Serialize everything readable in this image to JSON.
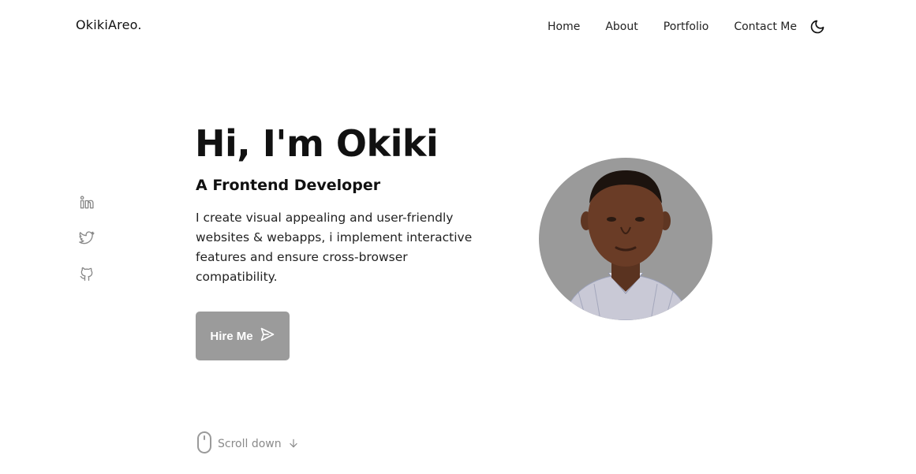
{
  "header": {
    "logo": "OkikiAreo.",
    "nav": [
      {
        "label": "Home"
      },
      {
        "label": "About"
      },
      {
        "label": "Portfolio"
      },
      {
        "label": "Contact Me"
      }
    ],
    "theme_toggle_icon": "moon-icon"
  },
  "social": [
    {
      "icon": "linkedin-icon"
    },
    {
      "icon": "twitter-icon"
    },
    {
      "icon": "github-icon"
    }
  ],
  "hero": {
    "title": "Hi, I'm Okiki",
    "subtitle": "A Frontend Developer",
    "description": "I create visual appealing and user-friendly websites & webapps, i implement interactive features and ensure cross-browser compatibility.",
    "cta_label": "Hire Me",
    "cta_icon": "send-icon",
    "avatar_icon": "profile-photo"
  },
  "scroll": {
    "label": "Scroll down",
    "mouse_icon": "mouse-icon",
    "arrow_icon": "arrow-down-icon"
  },
  "colors": {
    "accent": "#9b9b9b",
    "text": "#111111",
    "muted": "#8a8a8a",
    "background": "#ffffff"
  }
}
